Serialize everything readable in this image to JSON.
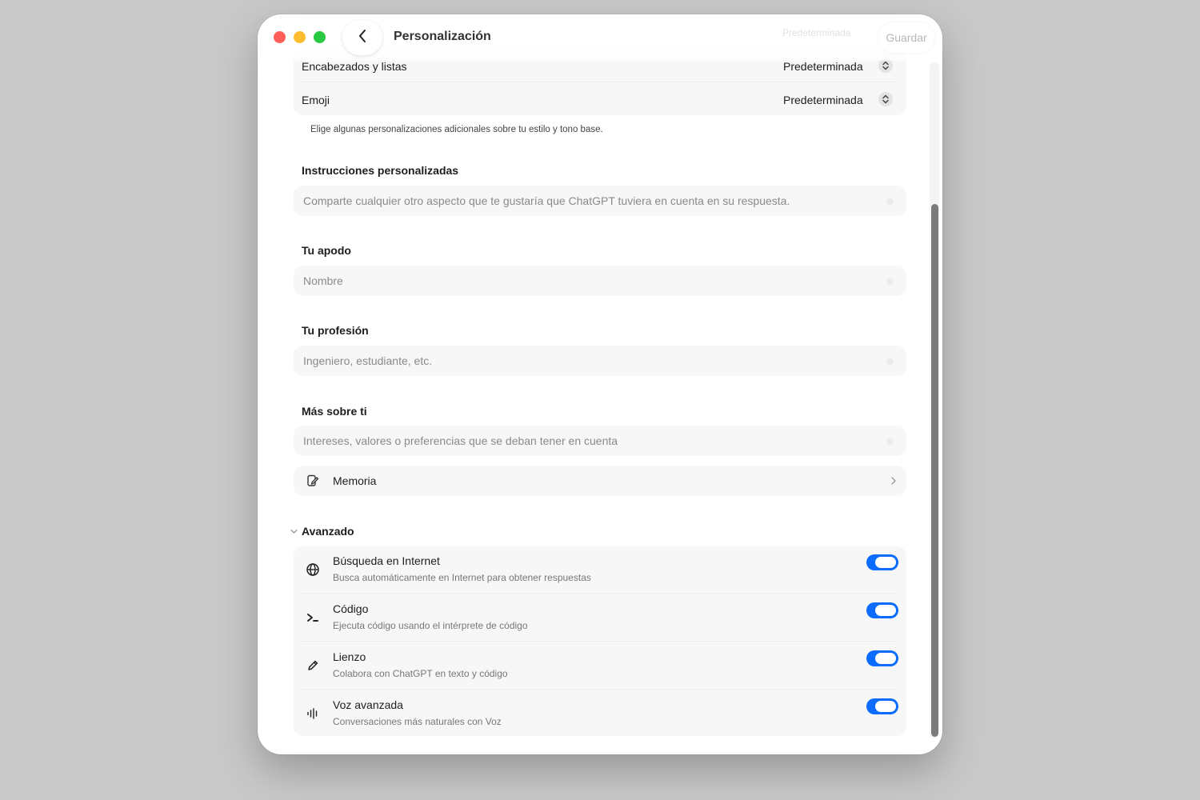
{
  "header": {
    "title": "Personalización",
    "faded_text": "Predeterminada",
    "save_label": "Guardar"
  },
  "style_options": [
    {
      "label": "Encabezados y listas",
      "value": "Predeterminada"
    },
    {
      "label": "Emoji",
      "value": "Predeterminada"
    }
  ],
  "caption": "Elige algunas personalizaciones adicionales sobre tu estilo y tono base.",
  "custom_instructions": {
    "title": "Instrucciones personalizadas",
    "placeholder": "Comparte cualquier otro aspecto que te gustaría que ChatGPT tuviera en cuenta en su respuesta."
  },
  "nickname": {
    "title": "Tu apodo",
    "placeholder": "Nombre"
  },
  "profession": {
    "title": "Tu profesión",
    "placeholder": "Ingeniero, estudiante, etc."
  },
  "more_about": {
    "title": "Más sobre ti",
    "placeholder": "Intereses, valores o preferencias que se deban tener en cuenta"
  },
  "memory": {
    "label": "Memoria"
  },
  "advanced": {
    "title": "Avanzado",
    "tools": [
      {
        "title": "Búsqueda en Internet",
        "description": "Busca automáticamente en Internet para obtener respuestas",
        "icon": "globe-icon",
        "enabled": true
      },
      {
        "title": "Código",
        "description": "Ejecuta código usando el intérprete de código",
        "icon": "terminal-icon",
        "enabled": true
      },
      {
        "title": "Lienzo",
        "description": "Colabora con ChatGPT en texto y código",
        "icon": "pencil-icon",
        "enabled": true
      },
      {
        "title": "Voz avanzada",
        "description": "Conversaciones más naturales con Voz",
        "icon": "waveform-icon",
        "enabled": true
      }
    ]
  },
  "colors": {
    "accent": "#0b6cff",
    "close": "#ff5f57",
    "minimize": "#febc2e",
    "zoom": "#28c840"
  }
}
